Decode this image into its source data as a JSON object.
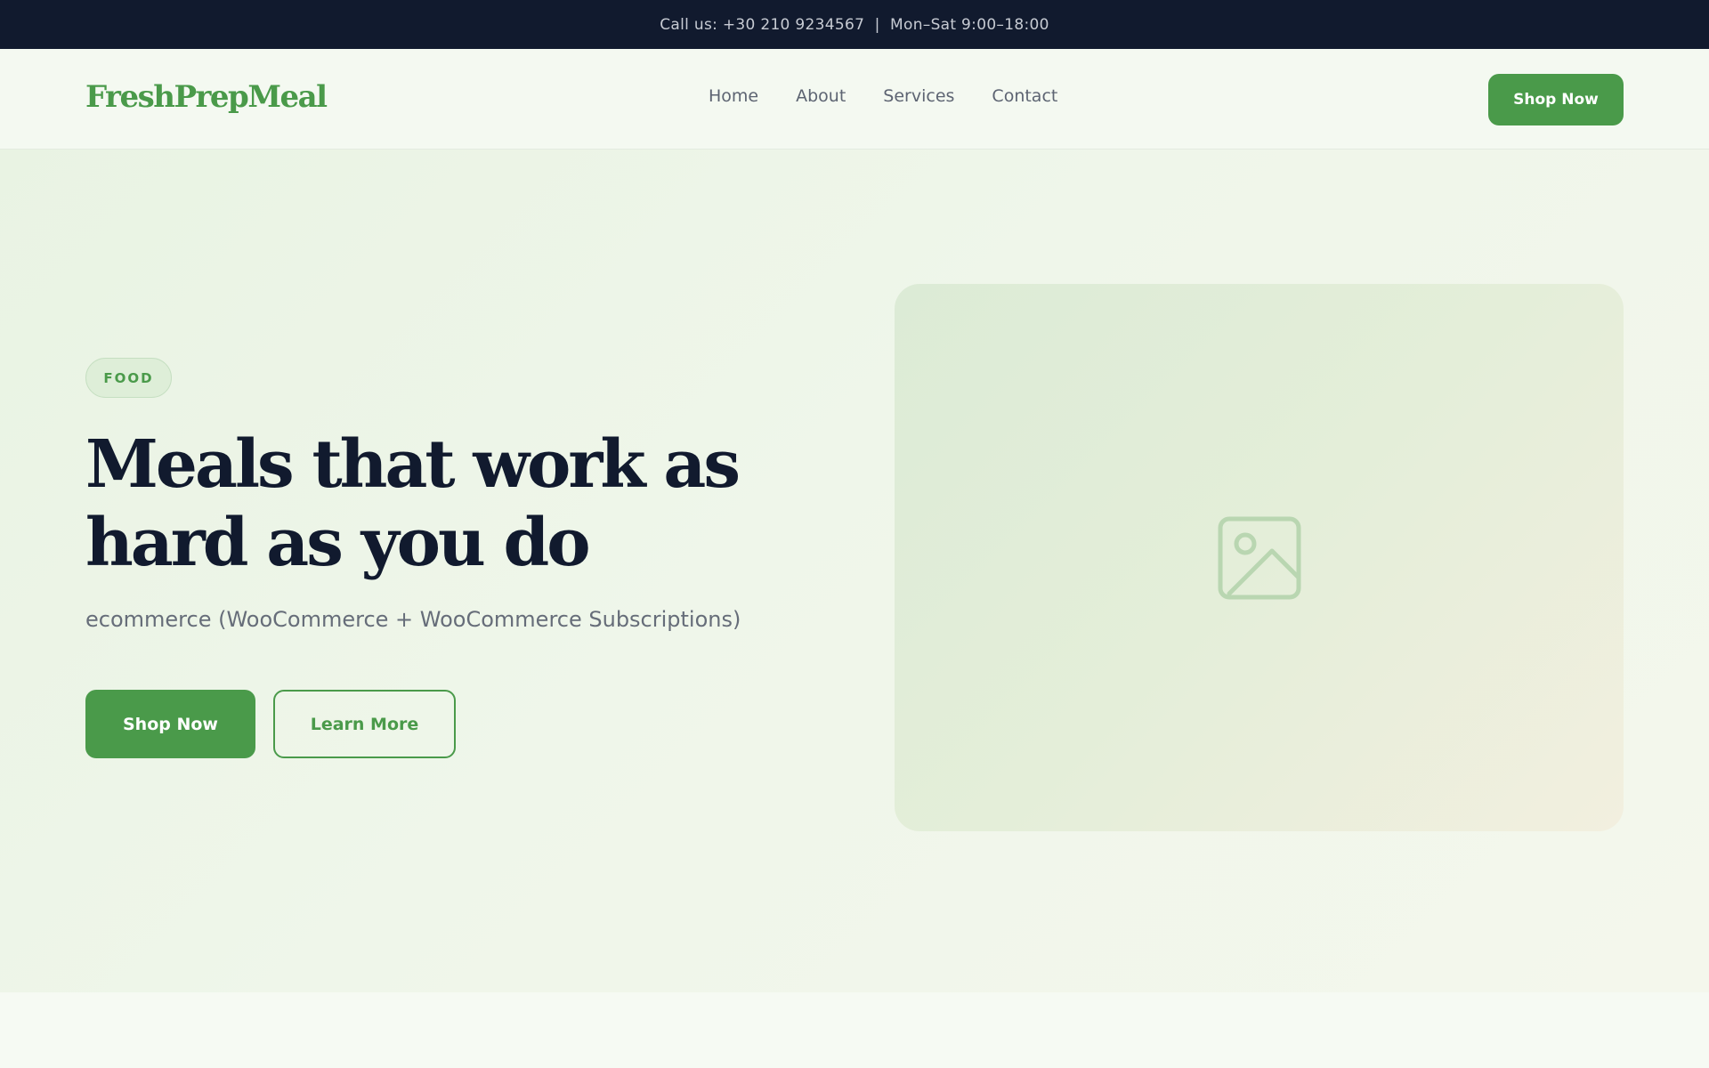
{
  "topbar": {
    "text": "Call us: +30 210 9234567  |  Mon–Sat 9:00–18:00"
  },
  "header": {
    "logo": "FreshPrepMeal",
    "nav": [
      "Home",
      "About",
      "Services",
      "Contact"
    ],
    "cta_label": "Shop Now"
  },
  "hero": {
    "badge": "FOOD",
    "headline": "Meals that work as hard as you do",
    "subtitle": "ecommerce (WooCommerce + WooCommerce Subscriptions)",
    "primary_label": "Shop Now",
    "secondary_label": "Learn More",
    "image_icon": "image-placeholder-icon"
  },
  "colors": {
    "brand_green": "#4a9a4a",
    "dark_navy": "#111a2e",
    "muted_text": "#666d79"
  }
}
